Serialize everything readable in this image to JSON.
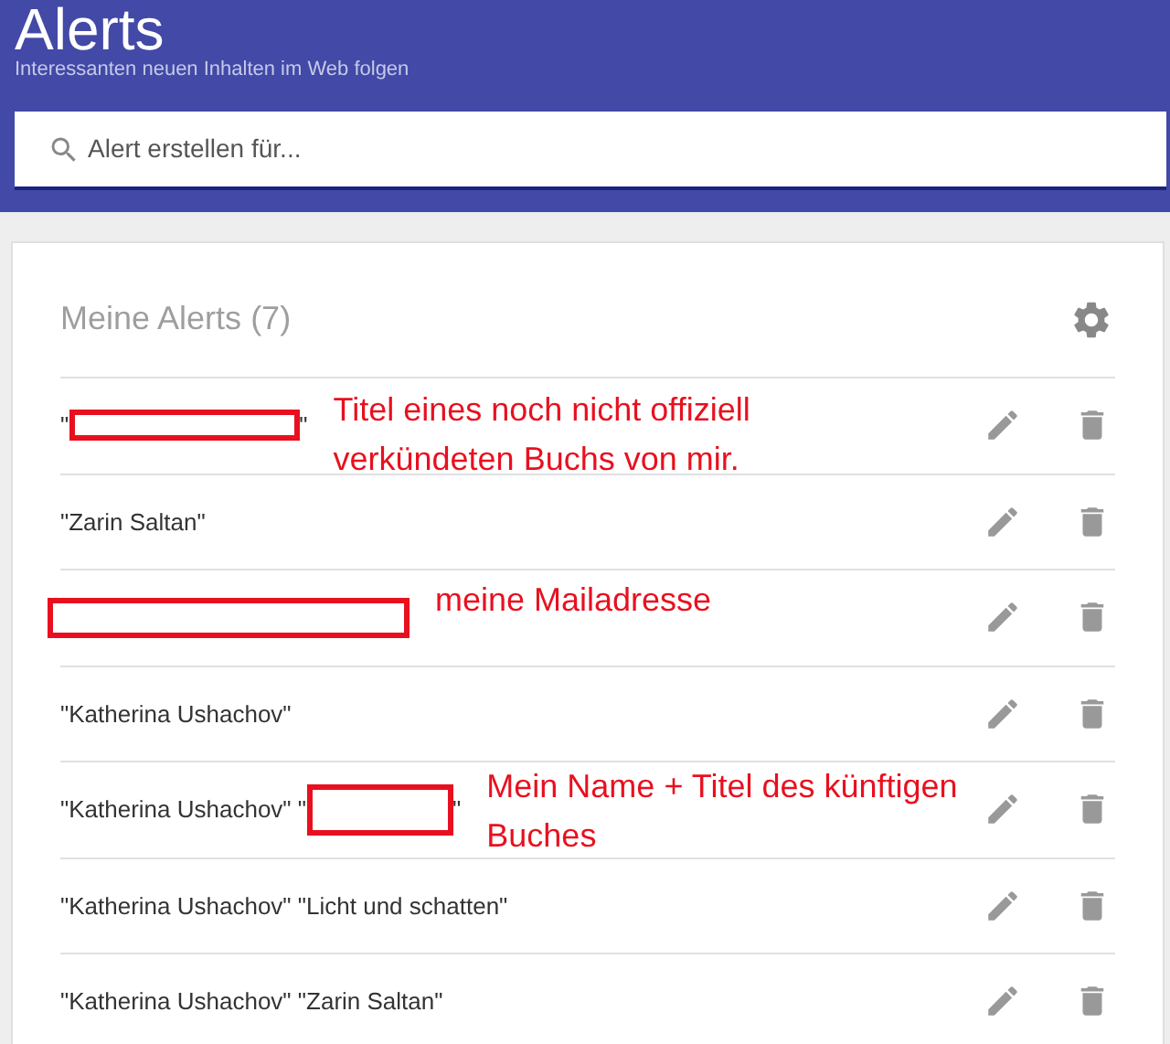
{
  "header": {
    "title": "Alerts",
    "subtitle": "Interessanten neuen Inhalten im Web folgen"
  },
  "search": {
    "placeholder": "Alert erstellen für..."
  },
  "alerts": {
    "title": "Meine Alerts",
    "count": "(7)",
    "rows": [
      {
        "parts": [
          {
            "kind": "text",
            "text": "\""
          },
          {
            "kind": "redaction"
          },
          {
            "kind": "text",
            "text": "\""
          }
        ],
        "annotation": "Titel eines noch nicht offiziell verkündeten Buchs von mir."
      },
      {
        "parts": [
          {
            "kind": "text",
            "text": "\"Zarin Saltan\""
          }
        ]
      },
      {
        "parts": [
          {
            "kind": "redaction"
          }
        ],
        "annotation": "meine Mailadresse"
      },
      {
        "parts": [
          {
            "kind": "text",
            "text": "\"Katherina Ushachov\""
          }
        ]
      },
      {
        "parts": [
          {
            "kind": "text",
            "text": "\"Katherina Ushachov\" \""
          },
          {
            "kind": "redaction"
          },
          {
            "kind": "text",
            "text": "\""
          }
        ],
        "annotation": "Mein Name + Titel des künftigen Buches"
      },
      {
        "parts": [
          {
            "kind": "text",
            "text": "\"Katherina Ushachov\" \"Licht und schatten\""
          }
        ]
      },
      {
        "parts": [
          {
            "kind": "text",
            "text": "\"Katherina Ushachov\" \"Zarin Saltan\""
          }
        ]
      }
    ]
  }
}
